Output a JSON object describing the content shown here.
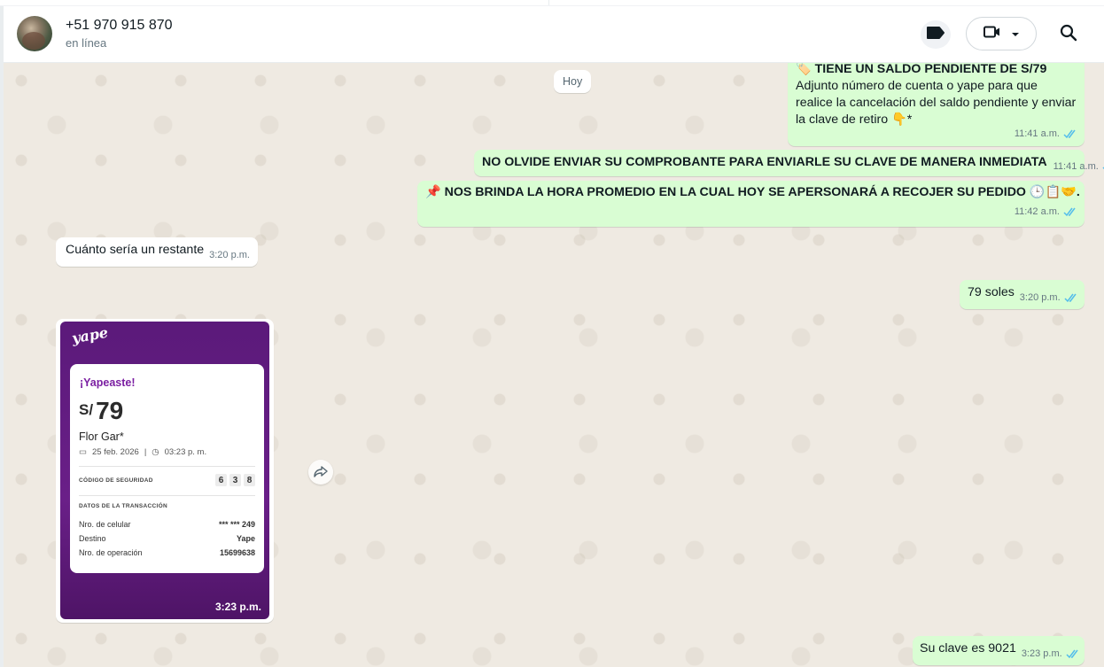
{
  "header": {
    "contact_name": "+51 970 915 870",
    "status": "en línea"
  },
  "colors": {
    "outgoing_bubble": "#d9fdd3",
    "incoming_bubble": "#ffffff",
    "chat_background": "#efeae2",
    "read_ticks": "#53bdeb",
    "yape_purple": "#6a1f88"
  },
  "icons": [
    "label-icon",
    "video-call-icon",
    "chevron-down-icon",
    "search-icon",
    "double-check-icon",
    "forward-icon"
  ],
  "chat": {
    "day_chip": "Hoy",
    "messages": [
      {
        "dir": "out",
        "title": "TIENE UN SALDO PENDIENTE DE S/79",
        "title_emoji": "🏷️",
        "body": " Adjunto número de cuenta o yape para que realice la cancelación del saldo pendiente y enviar la clave de retiro 👇*",
        "time": "11:41 a.m."
      },
      {
        "dir": "out",
        "text": "NO OLVIDE ENVIAR SU COMPROBANTE PARA ENVIARLE SU CLAVE DE MANERA INMEDIATA",
        "time": "11:41 a.m."
      },
      {
        "dir": "out",
        "text": "📌 NOS BRINDA LA HORA PROMEDIO EN LA CUAL HOY SE APERSONARÁ A RECOJER SU PEDIDO 🕒📋🤝.",
        "time": "11:42 a.m."
      },
      {
        "dir": "in",
        "text": "Cuánto sería un restante",
        "time": "3:20 p.m."
      },
      {
        "dir": "out",
        "text": "79 soles",
        "time": "3:20 p.m."
      },
      {
        "dir": "out",
        "text": "Su clave es 9021",
        "time": "3:23 p.m."
      }
    ],
    "image_message": {
      "time": "3:23 p.m.",
      "logo": "yape",
      "title": "¡Yapeaste!",
      "currency": "S/",
      "amount": "79",
      "name": "Flor Gar*",
      "date": "25 feb. 2026",
      "hour": "03:23 p. m.",
      "security_label": "CÓDIGO DE SEGURIDAD",
      "security_digits": [
        "6",
        "3",
        "8"
      ],
      "details_label": "DATOS DE LA TRANSACCIÓN",
      "rows": [
        {
          "label": "Nro. de celular",
          "value": "*** *** 249"
        },
        {
          "label": "Destino",
          "value": "Yape"
        },
        {
          "label": "Nro. de operación",
          "value": "15699638"
        }
      ]
    }
  }
}
